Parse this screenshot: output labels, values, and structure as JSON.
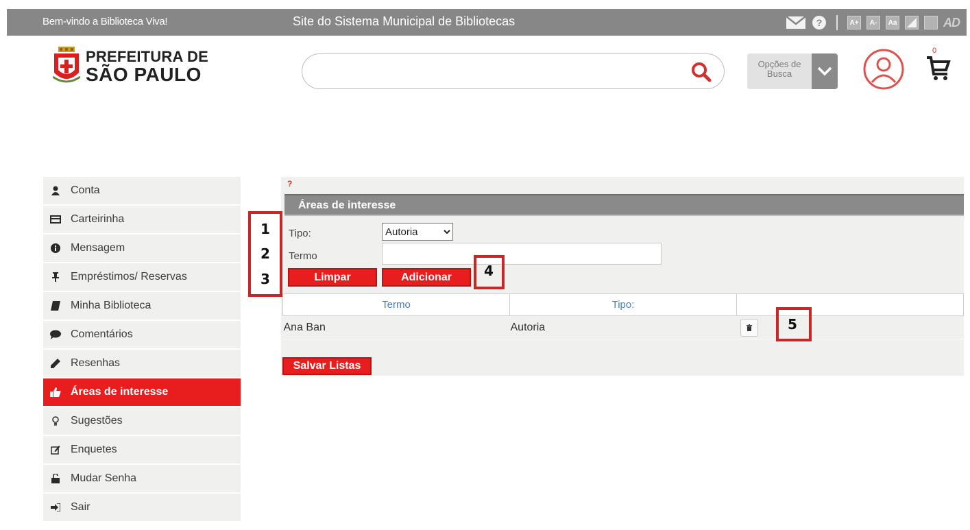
{
  "topbar": {
    "welcome": "Bem-vindo a Biblioteca Viva!",
    "site_title": "Site do Sistema Municipal de Bibliotecas",
    "tools": {
      "a_plus": "A+",
      "a_minus": "A-",
      "aa": "Aa",
      "ad": "AD"
    }
  },
  "header": {
    "logo_line1": "PREFEITURA DE",
    "logo_line2": "SÃO PAULO",
    "search_value": "",
    "search_options_label": "Opções de Busca",
    "cart_count": "0"
  },
  "sidebar": {
    "items": [
      {
        "label": "Conta",
        "icon": "user-icon"
      },
      {
        "label": "Carteirinha",
        "icon": "card-icon"
      },
      {
        "label": "Mensagem",
        "icon": "info-icon"
      },
      {
        "label": "Empréstimos/ Reservas",
        "icon": "pin-icon"
      },
      {
        "label": "Minha Biblioteca",
        "icon": "book-icon"
      },
      {
        "label": "Comentários",
        "icon": "comment-icon"
      },
      {
        "label": "Resenhas",
        "icon": "pencil-icon"
      },
      {
        "label": "Áreas de interesse",
        "icon": "thumbs-up-icon",
        "active": true
      },
      {
        "label": "Sugestões",
        "icon": "lightbulb-icon"
      },
      {
        "label": "Enquetes",
        "icon": "edit-icon"
      },
      {
        "label": "Mudar Senha",
        "icon": "lock-icon"
      },
      {
        "label": "Sair",
        "icon": "sign-out-icon"
      }
    ]
  },
  "main": {
    "help": "?",
    "heading": "Áreas de interesse",
    "tipo_label": "Tipo:",
    "tipo_value": "Autoria",
    "termo_label": "Termo",
    "termo_value": "",
    "limpar_label": "Limpar",
    "adicionar_label": "Adicionar",
    "table": {
      "headers": [
        "Termo",
        "Tipo:",
        ""
      ],
      "rows": [
        {
          "termo": "Ana Ban",
          "tipo": "Autoria"
        }
      ]
    },
    "salvar_label": "Salvar Listas"
  },
  "annotations": {
    "n1": "1",
    "n2": "2",
    "n3": "3",
    "n4": "4",
    "n5": "5"
  },
  "colors": {
    "accent_red": "#e81e1e",
    "topbar_gray": "#878787",
    "panel_bg": "#f0f0ee",
    "callout_red": "#c62828"
  }
}
